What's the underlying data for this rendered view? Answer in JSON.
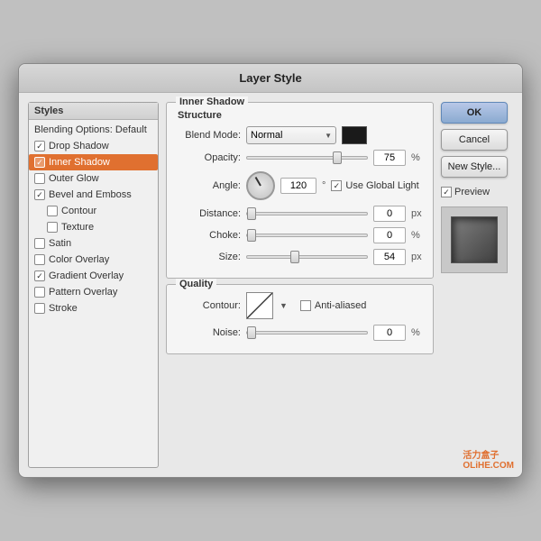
{
  "dialog": {
    "title": "Layer Style"
  },
  "styles_panel": {
    "header": "Styles",
    "items": [
      {
        "id": "blending-options",
        "label": "Blending Options: Default",
        "checked": false,
        "active": false,
        "indent": false
      },
      {
        "id": "drop-shadow",
        "label": "Drop Shadow",
        "checked": true,
        "active": false,
        "indent": false
      },
      {
        "id": "inner-shadow",
        "label": "Inner Shadow",
        "checked": true,
        "active": true,
        "indent": false
      },
      {
        "id": "outer-glow",
        "label": "Outer Glow",
        "checked": false,
        "active": false,
        "indent": false
      },
      {
        "id": "bevel-emboss",
        "label": "Bevel and Emboss",
        "checked": true,
        "active": false,
        "indent": false
      },
      {
        "id": "contour",
        "label": "Contour",
        "checked": false,
        "active": false,
        "indent": true
      },
      {
        "id": "texture",
        "label": "Texture",
        "checked": false,
        "active": false,
        "indent": true
      },
      {
        "id": "satin",
        "label": "Satin",
        "checked": false,
        "active": false,
        "indent": false
      },
      {
        "id": "color-overlay",
        "label": "Color Overlay",
        "checked": false,
        "active": false,
        "indent": false
      },
      {
        "id": "gradient-overlay",
        "label": "Gradient Overlay",
        "checked": true,
        "active": false,
        "indent": false
      },
      {
        "id": "pattern-overlay",
        "label": "Pattern Overlay",
        "checked": false,
        "active": false,
        "indent": false
      },
      {
        "id": "stroke",
        "label": "Stroke",
        "checked": false,
        "active": false,
        "indent": false
      }
    ]
  },
  "inner_shadow": {
    "section_title": "Inner Shadow",
    "structure_title": "Structure",
    "blend_mode": {
      "label": "Blend Mode:",
      "value": "Normal"
    },
    "opacity": {
      "label": "Opacity:",
      "value": "75",
      "unit": "%",
      "slider_pct": 75
    },
    "angle": {
      "label": "Angle:",
      "value": "120",
      "use_global_light_label": "Use Global Light",
      "use_global_light": true
    },
    "distance": {
      "label": "Distance:",
      "value": "0",
      "unit": "px",
      "slider_pct": 0
    },
    "choke": {
      "label": "Choke:",
      "value": "0",
      "unit": "%",
      "slider_pct": 0
    },
    "size": {
      "label": "Size:",
      "value": "54",
      "unit": "px",
      "slider_pct": 40
    }
  },
  "quality": {
    "section_title": "Quality",
    "contour_label": "Contour:",
    "anti_aliased_label": "Anti-aliased",
    "anti_aliased": false,
    "noise_label": "Noise:",
    "noise_value": "0",
    "noise_unit": "%",
    "noise_slider_pct": 0
  },
  "buttons": {
    "ok": "OK",
    "cancel": "Cancel",
    "new_style": "New Style...",
    "preview": "Preview"
  },
  "watermark": {
    "line1": "活力盒子",
    "line2": "OLiHE.COM"
  }
}
